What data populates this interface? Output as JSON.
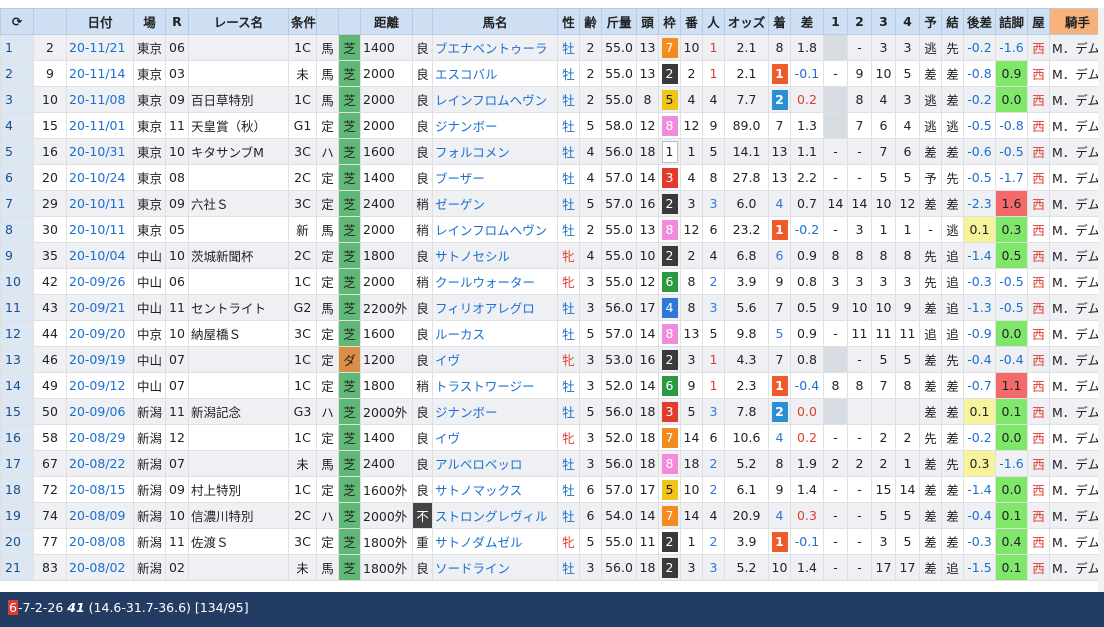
{
  "headers": {
    "refresh": "⟳",
    "date": "日付",
    "course": "場",
    "race": "R",
    "race_name": "レース名",
    "cond": "条件",
    "surface": "",
    "dist": "距離",
    "going": "",
    "horse": "馬名",
    "sex": "性",
    "age": "齢",
    "weight": "斤量",
    "heads": "頭",
    "gate": "枠",
    "num": "番",
    "pop": "人",
    "odds": "オッズ",
    "finish": "着",
    "margin": "差",
    "c1": "1",
    "c2": "2",
    "c3": "3",
    "c4": "4",
    "pred": "予",
    "result": "結",
    "diff": "後差",
    "diff2": "詰脚",
    "loc": "屋",
    "jockey": "騎手"
  },
  "rows": [
    [
      "1",
      "2",
      "20-11/21",
      "東京",
      "06",
      "",
      "1C",
      "馬",
      "芝",
      "1400",
      "良",
      "ブエナベントゥーラ",
      "牡",
      "2",
      "55.0",
      "13",
      "7",
      "10",
      "1",
      "2.1",
      "8",
      "1.8",
      "",
      "-",
      "3",
      "3",
      "逃",
      "先",
      "-0.2",
      "-1.6",
      "西",
      "M．デム"
    ],
    [
      "2",
      "9",
      "20-11/14",
      "東京",
      "03",
      "",
      "未",
      "馬",
      "芝",
      "2000",
      "良",
      "エスコバル",
      "牡",
      "2",
      "55.0",
      "13",
      "2",
      "2",
      "1",
      "2.1",
      "1",
      "-0.1",
      "-",
      "9",
      "10",
      "5",
      "差",
      "差",
      "-0.8",
      "0.9",
      "西",
      "M．デム"
    ],
    [
      "3",
      "10",
      "20-11/08",
      "東京",
      "09",
      "百日草特別",
      "1C",
      "馬",
      "芝",
      "2000",
      "良",
      "レインフロムヘヴン",
      "牡",
      "2",
      "55.0",
      "8",
      "5",
      "4",
      "4",
      "7.7",
      "2",
      "0.2",
      "",
      "8",
      "4",
      "3",
      "逃",
      "差",
      "-0.2",
      "0.0",
      "西",
      "M．デム"
    ],
    [
      "4",
      "15",
      "20-11/01",
      "東京",
      "11",
      "天皇賞（秋）",
      "G1",
      "定",
      "芝",
      "2000",
      "良",
      "ジナンボー",
      "牡",
      "5",
      "58.0",
      "12",
      "8",
      "12",
      "9",
      "89.0",
      "7",
      "1.3",
      "",
      "7",
      "6",
      "4",
      "逃",
      "逃",
      "-0.5",
      "-0.8",
      "西",
      "M．デム"
    ],
    [
      "5",
      "16",
      "20-10/31",
      "東京",
      "10",
      "キタサンブM",
      "3C",
      "ハ",
      "芝",
      "1600",
      "良",
      "フォルコメン",
      "牡",
      "4",
      "56.0",
      "18",
      "1",
      "1",
      "5",
      "14.1",
      "13",
      "1.1",
      "-",
      "-",
      "7",
      "6",
      "差",
      "差",
      "-0.6",
      "-0.5",
      "西",
      "M．デム"
    ],
    [
      "6",
      "20",
      "20-10/24",
      "東京",
      "08",
      "",
      "2C",
      "定",
      "芝",
      "1400",
      "良",
      "ブーザー",
      "牡",
      "4",
      "57.0",
      "14",
      "3",
      "4",
      "8",
      "27.8",
      "13",
      "2.2",
      "-",
      "-",
      "5",
      "5",
      "予",
      "先",
      "-0.5",
      "-1.7",
      "西",
      "M．デム"
    ],
    [
      "7",
      "29",
      "20-10/11",
      "東京",
      "09",
      "六社Ｓ",
      "3C",
      "定",
      "芝",
      "2400",
      "稍",
      "ゼーゲン",
      "牡",
      "5",
      "57.0",
      "16",
      "2",
      "3",
      "3",
      "6.0",
      "4",
      "0.7",
      "14",
      "14",
      "10",
      "12",
      "差",
      "差",
      "-2.3",
      "1.6",
      "西",
      "M．デム"
    ],
    [
      "8",
      "30",
      "20-10/11",
      "東京",
      "05",
      "",
      "新",
      "馬",
      "芝",
      "2000",
      "稍",
      "レインフロムヘヴン",
      "牡",
      "2",
      "55.0",
      "13",
      "8",
      "12",
      "6",
      "23.2",
      "1",
      "-0.2",
      "-",
      "3",
      "1",
      "1",
      "-",
      "逃",
      "0.1",
      "0.3",
      "西",
      "M．デム"
    ],
    [
      "9",
      "35",
      "20-10/04",
      "中山",
      "10",
      "茨城新聞杯",
      "2C",
      "定",
      "芝",
      "1800",
      "良",
      "サトノセシル",
      "牝",
      "4",
      "55.0",
      "10",
      "2",
      "2",
      "4",
      "6.8",
      "6",
      "0.9",
      "8",
      "8",
      "8",
      "8",
      "先",
      "追",
      "-1.4",
      "0.5",
      "西",
      "M．デム"
    ],
    [
      "10",
      "42",
      "20-09/26",
      "中山",
      "06",
      "",
      "1C",
      "定",
      "芝",
      "2000",
      "稍",
      "クールウォーター",
      "牝",
      "3",
      "55.0",
      "12",
      "6",
      "8",
      "2",
      "3.9",
      "9",
      "0.8",
      "3",
      "3",
      "3",
      "3",
      "先",
      "追",
      "-0.3",
      "-0.5",
      "西",
      "M．デム"
    ],
    [
      "11",
      "43",
      "20-09/21",
      "中山",
      "11",
      "セントライト",
      "G2",
      "馬",
      "芝",
      "2200外",
      "良",
      "フィリオアレグロ",
      "牡",
      "3",
      "56.0",
      "17",
      "4",
      "8",
      "3",
      "5.6",
      "7",
      "0.5",
      "9",
      "10",
      "10",
      "9",
      "差",
      "追",
      "-1.3",
      "-0.5",
      "西",
      "M．デム"
    ],
    [
      "12",
      "44",
      "20-09/20",
      "中京",
      "10",
      "納屋橋Ｓ",
      "3C",
      "定",
      "芝",
      "1600",
      "良",
      "ルーカス",
      "牡",
      "5",
      "57.0",
      "14",
      "8",
      "13",
      "5",
      "9.8",
      "5",
      "0.9",
      "-",
      "11",
      "11",
      "11",
      "追",
      "追",
      "-0.9",
      "0.0",
      "西",
      "M．デム"
    ],
    [
      "13",
      "46",
      "20-09/19",
      "中山",
      "07",
      "",
      "1C",
      "定",
      "ダ",
      "1200",
      "良",
      "イヴ",
      "牝",
      "3",
      "53.0",
      "16",
      "2",
      "3",
      "1",
      "4.3",
      "7",
      "0.8",
      "",
      "-",
      "5",
      "5",
      "差",
      "先",
      "-0.4",
      "-0.4",
      "西",
      "M．デム"
    ],
    [
      "14",
      "49",
      "20-09/12",
      "中山",
      "07",
      "",
      "1C",
      "定",
      "芝",
      "1800",
      "稍",
      "トラストワージー",
      "牡",
      "3",
      "52.0",
      "14",
      "6",
      "9",
      "1",
      "2.3",
      "1",
      "-0.4",
      "8",
      "8",
      "7",
      "8",
      "差",
      "差",
      "-0.7",
      "1.1",
      "西",
      "M．デム"
    ],
    [
      "15",
      "50",
      "20-09/06",
      "新潟",
      "11",
      "新潟記念",
      "G3",
      "ハ",
      "芝",
      "2000外",
      "良",
      "ジナンボー",
      "牡",
      "5",
      "56.0",
      "18",
      "3",
      "5",
      "3",
      "7.8",
      "2",
      "0.0",
      "",
      "",
      "",
      "",
      "差",
      "差",
      "0.1",
      "0.1",
      "西",
      "M．デム"
    ],
    [
      "16",
      "58",
      "20-08/29",
      "新潟",
      "12",
      "",
      "1C",
      "定",
      "芝",
      "1400",
      "良",
      "イヴ",
      "牝",
      "3",
      "52.0",
      "18",
      "7",
      "14",
      "6",
      "10.6",
      "4",
      "0.2",
      "-",
      "-",
      "2",
      "2",
      "先",
      "差",
      "-0.2",
      "0.0",
      "西",
      "M．デム"
    ],
    [
      "17",
      "67",
      "20-08/22",
      "新潟",
      "07",
      "",
      "未",
      "馬",
      "芝",
      "2400",
      "良",
      "アルベロベッロ",
      "牡",
      "3",
      "56.0",
      "18",
      "8",
      "18",
      "2",
      "5.2",
      "8",
      "1.9",
      "2",
      "2",
      "2",
      "1",
      "差",
      "先",
      "0.3",
      "-1.6",
      "西",
      "M．デム"
    ],
    [
      "18",
      "72",
      "20-08/15",
      "新潟",
      "09",
      "村上特別",
      "1C",
      "定",
      "芝",
      "1600外",
      "良",
      "サトノマックス",
      "牡",
      "6",
      "57.0",
      "17",
      "5",
      "10",
      "2",
      "6.1",
      "9",
      "1.4",
      "-",
      "-",
      "15",
      "14",
      "差",
      "差",
      "-1.4",
      "0.0",
      "西",
      "M．デム"
    ],
    [
      "19",
      "74",
      "20-08/09",
      "新潟",
      "10",
      "信濃川特別",
      "2C",
      "ハ",
      "芝",
      "2000外",
      "不",
      "ストロングレヴィル",
      "牡",
      "6",
      "54.0",
      "14",
      "7",
      "14",
      "4",
      "20.9",
      "4",
      "0.3",
      "-",
      "-",
      "5",
      "5",
      "差",
      "差",
      "-0.4",
      "0.1",
      "西",
      "M．デム"
    ],
    [
      "20",
      "77",
      "20-08/08",
      "新潟",
      "11",
      "佐渡Ｓ",
      "3C",
      "定",
      "芝",
      "1800外",
      "重",
      "サトノダムゼル",
      "牝",
      "5",
      "55.0",
      "11",
      "2",
      "1",
      "2",
      "3.9",
      "1",
      "-0.1",
      "-",
      "-",
      "3",
      "5",
      "差",
      "差",
      "-0.3",
      "0.4",
      "西",
      "M．デム"
    ],
    [
      "21",
      "83",
      "20-08/02",
      "新潟",
      "02",
      "",
      "未",
      "馬",
      "芝",
      "1800外",
      "良",
      "ソードライン",
      "牡",
      "3",
      "56.0",
      "18",
      "2",
      "3",
      "3",
      "5.2",
      "10",
      "1.4",
      "-",
      "-",
      "17",
      "17",
      "差",
      "追",
      "-1.5",
      "0.1",
      "西",
      "M．デム"
    ]
  ],
  "status": {
    "first": "6",
    "rest": "-7-2-26 ",
    "bold": "41",
    "tail": " (14.6-31.7-36.6) [134/95]"
  }
}
